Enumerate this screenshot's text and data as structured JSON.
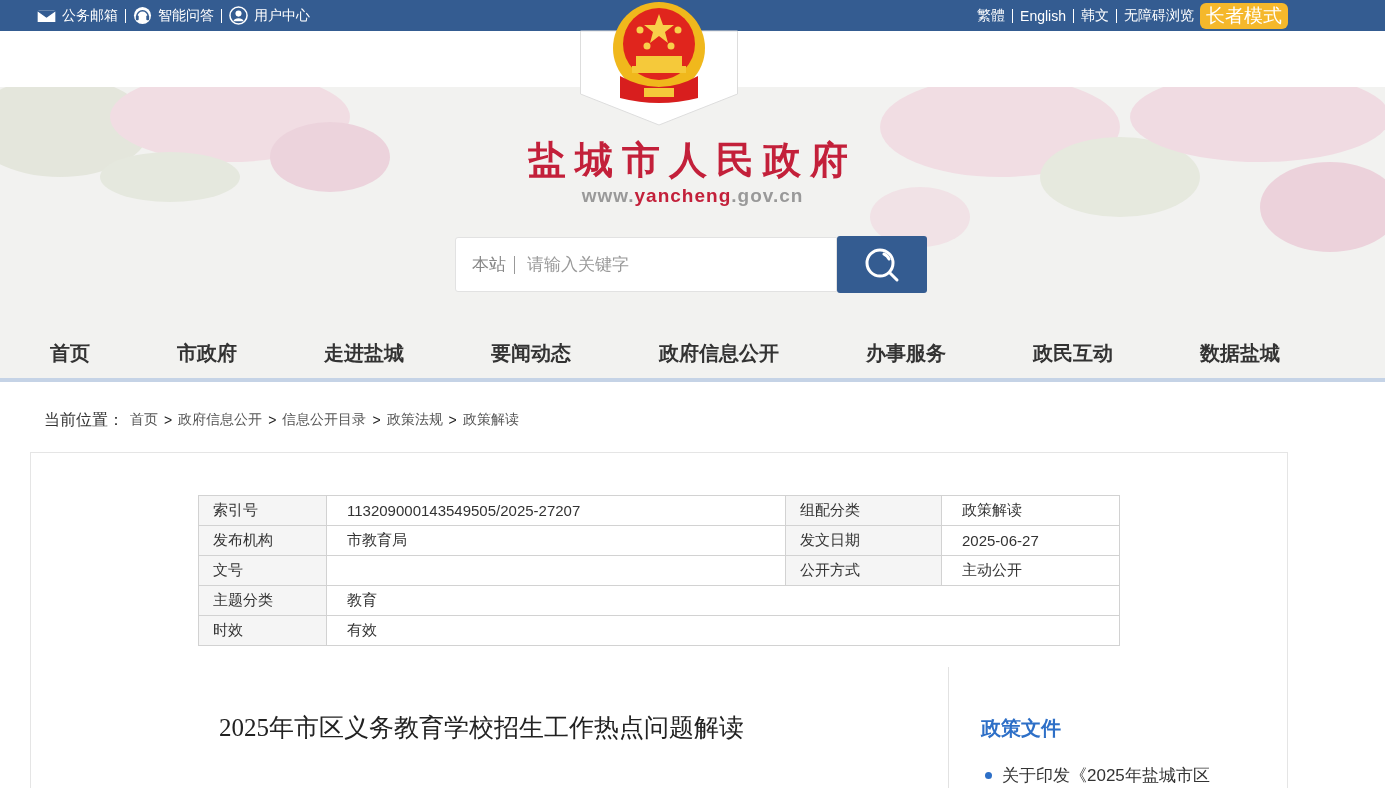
{
  "top_bar": {
    "left_links": [
      {
        "label": "公务邮箱"
      },
      {
        "label": "智能问答"
      },
      {
        "label": "用户中心"
      }
    ],
    "right_links": [
      "繁體",
      "English",
      "韩文",
      "无障碍浏览"
    ],
    "elder_mode": "长者模式"
  },
  "site": {
    "title": "盐城市人民政府",
    "url_parts": [
      {
        "text": "www.",
        "highlight": false
      },
      {
        "text": "yancheng",
        "highlight": true
      },
      {
        "text": ".gov.cn",
        "highlight": false
      }
    ]
  },
  "search": {
    "scope": "本站",
    "placeholder": "请输入关键字"
  },
  "nav": [
    "首页",
    "市政府",
    "走进盐城",
    "要闻动态",
    "政府信息公开",
    "办事服务",
    "政民互动",
    "数据盐城"
  ],
  "breadcrumb": {
    "label": "当前位置：",
    "items": [
      {
        "text": "首页",
        "kind": "link"
      },
      {
        "text": ">",
        "kind": "separator"
      },
      {
        "text": "政府信息公开",
        "kind": "link"
      },
      {
        "text": ">",
        "kind": "separator"
      },
      {
        "text": "信息公开目录",
        "kind": "link"
      },
      {
        "text": ">",
        "kind": "separator"
      },
      {
        "text": "政策法规",
        "kind": "link"
      },
      {
        "text": ">",
        "kind": "separator"
      },
      {
        "text": "政策解读",
        "kind": "link"
      }
    ]
  },
  "info_table": {
    "rows": [
      [
        {
          "label": "索引号",
          "value": "113209000143549505/2025-27207"
        },
        {
          "label": "组配分类",
          "value": "政策解读"
        }
      ],
      [
        {
          "label": "发布机构",
          "value": "市教育局"
        },
        {
          "label": "发文日期",
          "value": "2025-06-27"
        }
      ],
      [
        {
          "label": "文号"
        },
        {
          "label": "公开方式",
          "value": "主动公开"
        }
      ],
      [
        {
          "label": "主题分类",
          "value": "教育"
        }
      ],
      [
        {
          "label": "时效",
          "value": "有效"
        }
      ]
    ]
  },
  "article": {
    "title": "2025年市区义务教育学校招生工作热点问题解读"
  },
  "sidebar": {
    "heading": "政策文件",
    "items": [
      "关于印发《2025年盐城市区"
    ]
  }
}
